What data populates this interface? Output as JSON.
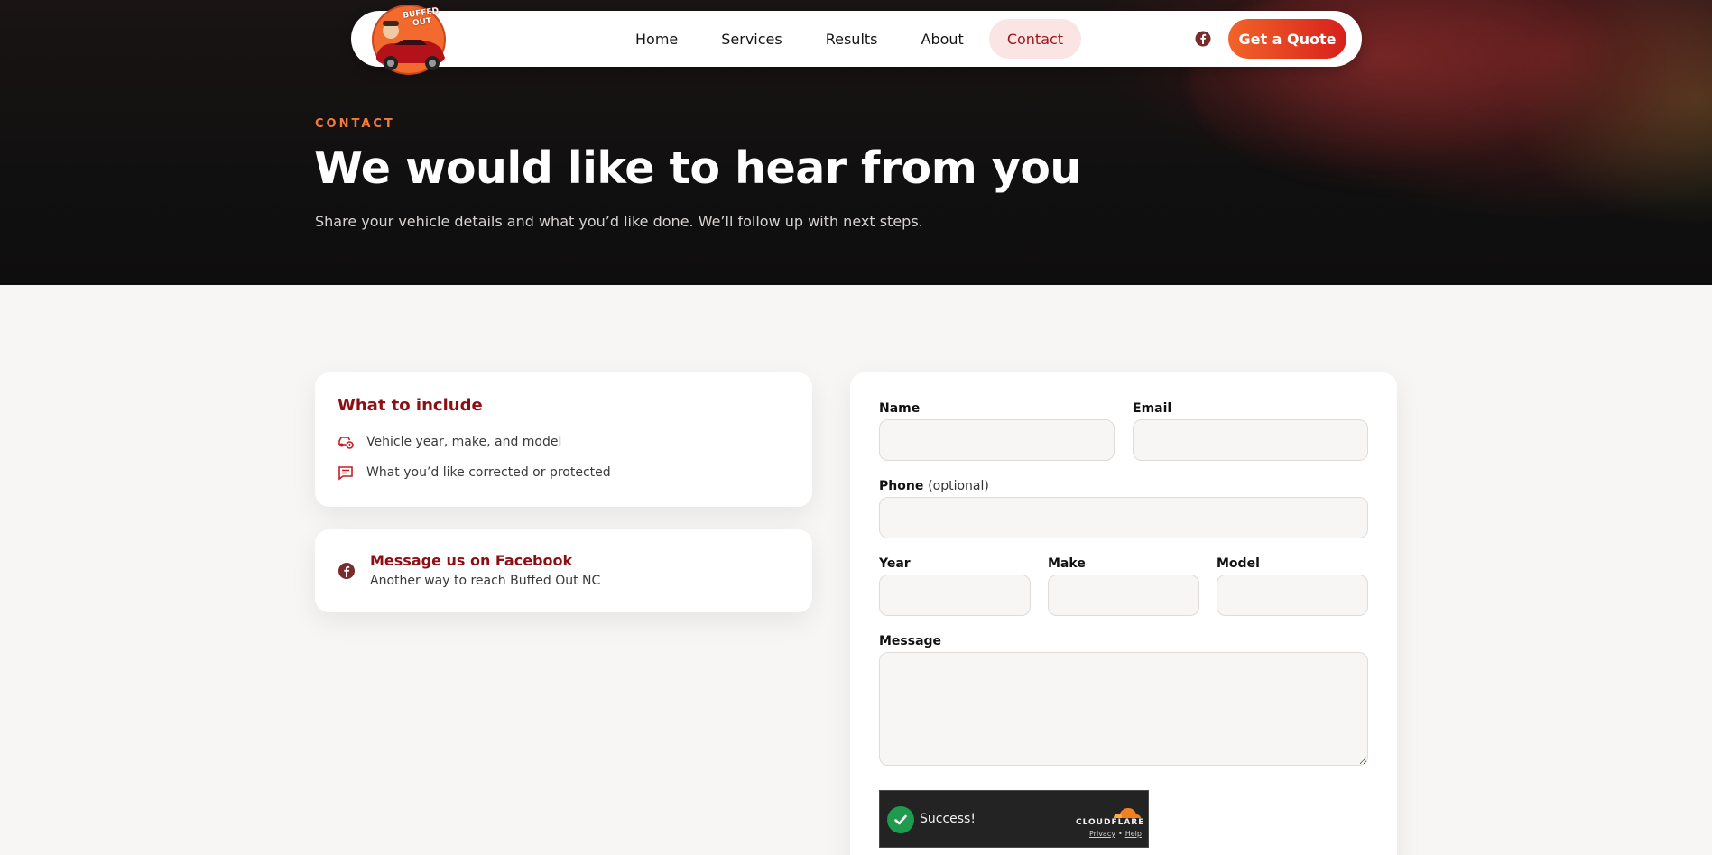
{
  "nav": {
    "logo_text": "BUFFED OUT",
    "links": [
      {
        "label": "Home"
      },
      {
        "label": "Services"
      },
      {
        "label": "Results"
      },
      {
        "label": "About"
      },
      {
        "label": "Contact",
        "active": true
      }
    ],
    "facebook_icon": "facebook-icon",
    "quote_label": "Get a Quote"
  },
  "hero": {
    "eyebrow": "CONTACT",
    "title": "We would like to hear from you",
    "subtitle": "Share your vehicle details and what you’d like done. We’ll follow up with next steps."
  },
  "include_card": {
    "title": "What to include",
    "items": [
      {
        "icon": "car-info-icon",
        "text": "Vehicle year, make, and model"
      },
      {
        "icon": "message-icon",
        "text": "What you’d like corrected or protected"
      }
    ]
  },
  "facebook_card": {
    "icon": "facebook-icon",
    "title": "Message us on Facebook",
    "subtitle": "Another way to reach Buffed Out NC"
  },
  "form": {
    "name_label": "Name",
    "email_label": "Email",
    "phone_label": "Phone",
    "phone_optional": "(optional)",
    "year_label": "Year",
    "make_label": "Make",
    "model_label": "Model",
    "message_label": "Message",
    "name_value": "",
    "email_value": "",
    "phone_value": "",
    "year_value": "",
    "make_value": "",
    "model_value": "",
    "message_value": ""
  },
  "turnstile": {
    "status": "Success!",
    "brand": "CLOUDFLARE",
    "privacy": "Privacy",
    "separator": "•",
    "help": "Help"
  },
  "colors": {
    "brand_red": "#8c0f14",
    "accent_orange": "#f47a3c",
    "button_gradient_start": "#f2642a",
    "button_gradient_end": "#d6201c",
    "success_green": "#1e9b4c"
  }
}
